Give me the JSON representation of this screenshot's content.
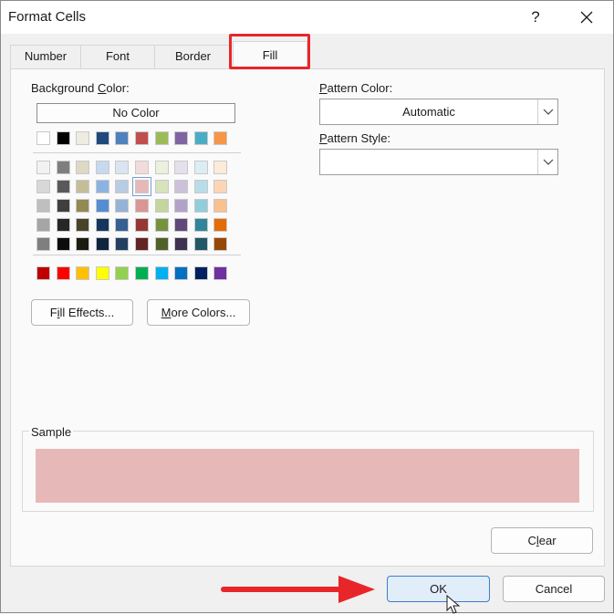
{
  "window": {
    "title": "Format Cells",
    "help": "?"
  },
  "tabs": [
    {
      "label": "Number"
    },
    {
      "label": "Font"
    },
    {
      "label": "Border"
    },
    {
      "label": "Fill"
    }
  ],
  "fill": {
    "background_label_pre": "Background ",
    "background_label_key": "C",
    "background_label_post": "olor:",
    "no_color_label": "No Color",
    "selected_color": "#E6B8B7",
    "theme_row1": [
      "#FFFFFF",
      "#000000",
      "#EEECE1",
      "#1F497D",
      "#4F81BD",
      "#C0504D",
      "#9BBB59",
      "#8064A2",
      "#4BACC6",
      "#F79646"
    ],
    "theme_tints": [
      [
        "#F2F2F2",
        "#7F7F7F",
        "#DDD9C3",
        "#C6D9F0",
        "#DBE5F1",
        "#F2DCDB",
        "#EBF1DD",
        "#E5E0EC",
        "#DBEEF3",
        "#FDEADA"
      ],
      [
        "#D8D8D8",
        "#595959",
        "#C4BD97",
        "#8DB3E2",
        "#B8CCE4",
        "#E6B8B7",
        "#D7E3BC",
        "#CCC1D9",
        "#B7DDE8",
        "#FBD5B5"
      ],
      [
        "#BFBFBF",
        "#3F3F3F",
        "#938953",
        "#548DD4",
        "#95B3D7",
        "#D99694",
        "#C3D69B",
        "#B2A2C7",
        "#92CDDC",
        "#FAC08F"
      ],
      [
        "#A5A5A5",
        "#262626",
        "#494429",
        "#17365D",
        "#366092",
        "#953734",
        "#76923C",
        "#5F497A",
        "#31859B",
        "#E36C09"
      ],
      [
        "#7F7F7F",
        "#0C0C0C",
        "#1D1B10",
        "#0F243E",
        "#244061",
        "#632423",
        "#4F6128",
        "#3F3151",
        "#205867",
        "#974806"
      ]
    ],
    "standard_colors": [
      "#C00000",
      "#FF0000",
      "#FFC000",
      "#FFFF00",
      "#92D050",
      "#00B050",
      "#00B0F0",
      "#0070C0",
      "#002060",
      "#7030A0"
    ],
    "fill_effects_key": "i",
    "fill_effects_pre": "F",
    "fill_effects_post": "ll Effects...",
    "more_colors_key": "M",
    "more_colors_post": "ore Colors...",
    "pattern_color_key": "P",
    "pattern_color_post": "attern Color:",
    "pattern_color_value": "Automatic",
    "pattern_style_key": "P",
    "pattern_style_post": "attern Style:",
    "pattern_style_value": "",
    "sample_label": "Sample",
    "clear_pre": "C",
    "clear_key": "l",
    "clear_post": "ear"
  },
  "footer": {
    "ok_label": "OK",
    "cancel_label": "Cancel"
  },
  "colors": {
    "accent_highlight": "#E8262A",
    "ok_bg": "#E1EDF8",
    "ok_border": "#3C7ECC"
  },
  "icons": [
    "close-icon",
    "chevron-down-icon",
    "arrow-right-icon",
    "mouse-cursor-icon"
  ]
}
